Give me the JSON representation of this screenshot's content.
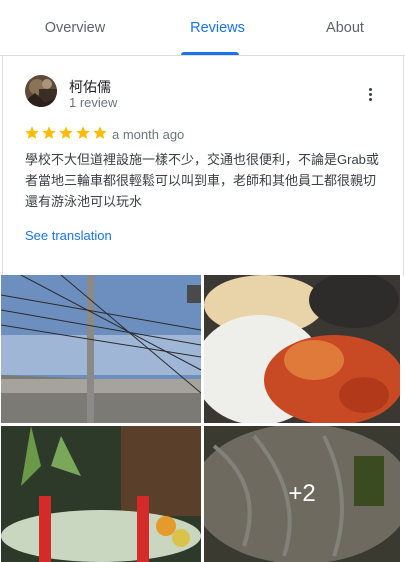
{
  "tabs": [
    {
      "label": "Overview",
      "active": false
    },
    {
      "label": "Reviews",
      "active": true
    },
    {
      "label": "About",
      "active": false
    }
  ],
  "accent_color": "#1a73e8",
  "review": {
    "reviewer_name": "柯佑儒",
    "review_count": "1 review",
    "rating": 5,
    "rating_max": 5,
    "date": "a month ago",
    "text": "學校不大但道裡設施一樣不少，交通也很便利，不論是Grab或者當地三輪車都很輕鬆可以叫到車，老師和其他員工都很親切還有游泳池可以玩水",
    "see_translation": "See translation",
    "menu_icon": "more-vert-icon"
  },
  "photos": {
    "items": [
      {
        "subject": "street-power-lines"
      },
      {
        "subject": "rice-and-curry-dish"
      },
      {
        "subject": "drinks-and-plants"
      },
      {
        "subject": "noodle-bowl"
      }
    ],
    "more_count": "+2"
  }
}
